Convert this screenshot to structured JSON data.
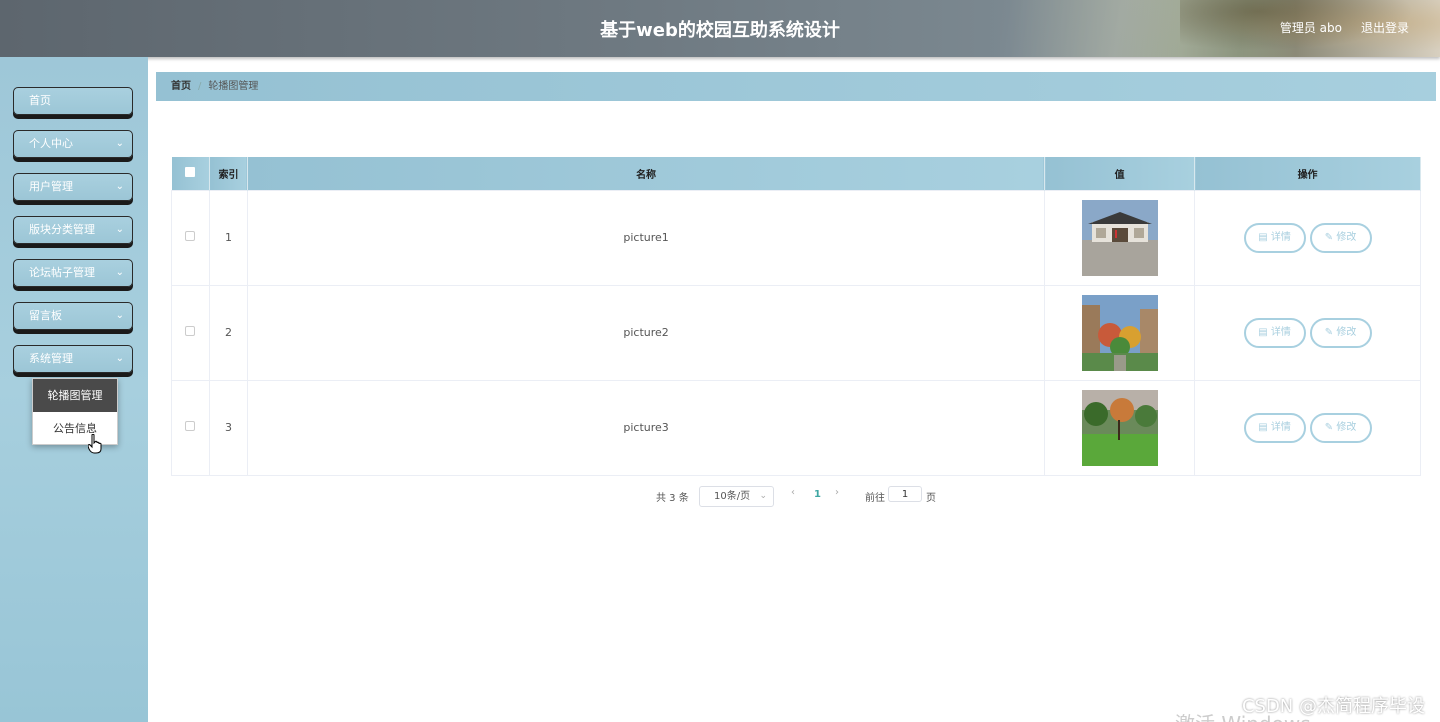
{
  "header": {
    "title": "基于web的校园互助系统设计",
    "user": "管理员 abo",
    "logout": "退出登录"
  },
  "sidebar": {
    "items": [
      {
        "label": "首页"
      },
      {
        "label": "个人中心"
      },
      {
        "label": "用户管理"
      },
      {
        "label": "版块分类管理"
      },
      {
        "label": "论坛帖子管理"
      },
      {
        "label": "留言板"
      },
      {
        "label": "系统管理"
      }
    ],
    "submenu": [
      {
        "label": "轮播图管理",
        "active": true
      },
      {
        "label": "公告信息",
        "active": false
      }
    ]
  },
  "breadcrumb": {
    "home": "首页",
    "separator": "/",
    "current": "轮播图管理"
  },
  "table": {
    "headers": [
      "索引",
      "名称",
      "值",
      "操作"
    ],
    "rows": [
      {
        "index": "1",
        "name": "picture1",
        "image": "campus-building-photo"
      },
      {
        "index": "2",
        "name": "picture2",
        "image": "campus-autumn-trees-photo"
      },
      {
        "index": "3",
        "name": "picture3",
        "image": "campus-garden-lawn-photo"
      }
    ],
    "detail_label": "详情",
    "edit_label": "修改"
  },
  "pagination": {
    "total": "共 3 条",
    "page_size": "10条/页",
    "current_page": "1",
    "goto_label": "前往",
    "goto_value": "1",
    "page_unit": "页"
  },
  "watermark": "CSDN @杰简程序毕设",
  "os_watermark": "激活 Windows"
}
